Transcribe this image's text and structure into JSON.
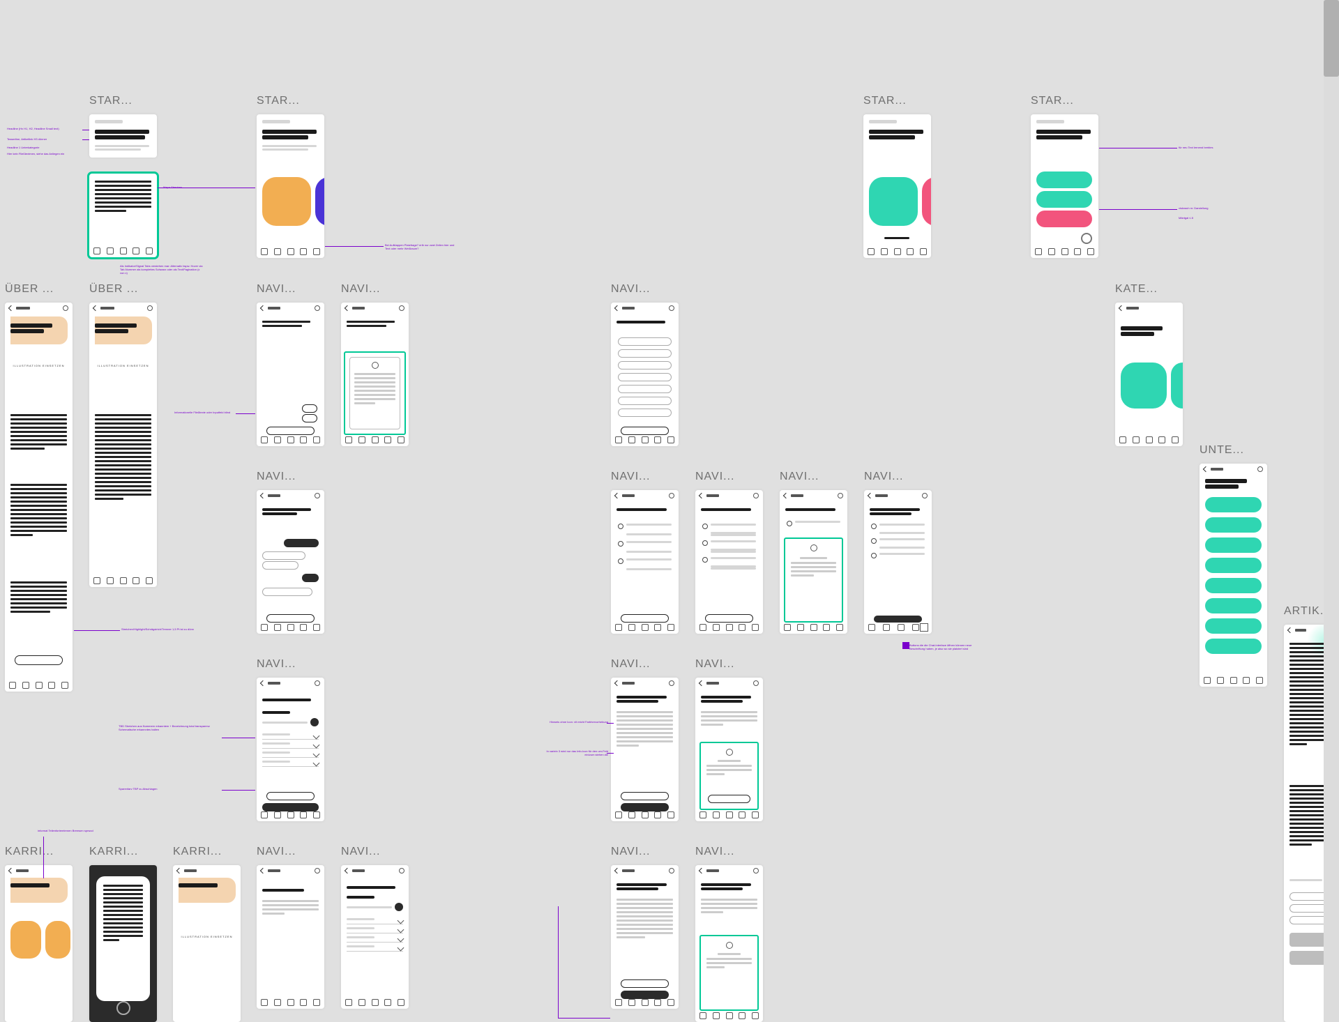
{
  "labels": {
    "star": "STAR...",
    "uber": "ÜBER ...",
    "navi": "NAVI...",
    "kate": "KATE...",
    "unte": "UNTE...",
    "artik": "ARTIK...",
    "karri": "KARRI..."
  },
  "illustration_placeholder": "ILLUSTRATION\nEINSETZEN",
  "annotations": {
    "a1": "Headline (Hx H1, H2, Headline Small text)",
    "a2": "Teaserline, Artikellink H3 dünner",
    "a3": "Headline 1 Unterkategorie",
    "a4": "Hier kein Fließtextmen, siehe das Anliegen ein",
    "a5": "Mapa Strecken",
    "a6": "Als Indikator/Signal Tabs verstehen mar:\nAlternativ bspw. Hover via Tab-Nummer als komplettes Schwarz oder als Text/Pagination (x von x)",
    "a7": "Bei Aufklappen Platzfrage? erlb nur zwei Zeilen hier und Text oder mehr Weißraum?",
    "a8": "Informationelle Fließtexte oder Inputfeld blind",
    "a9": "Streichen/Highlight/Schrägstrich/Trenner 1,5 Pt ist zu dünn",
    "a10": "TBD\nStreichen aus Nummern erkanntem\n+ Bezeichnung total transparenz\nSchematische erkannntes halten",
    "a11": "Sparenfarv TBP zu Abschlagen",
    "a12": "Hinweis ohne Icon: vlt reicht Farbhervorhebung",
    "a13": "In variein 3 wird nur das Info-Icon für den um-Feld ein/zum stehen die",
    "a14": "Buttons die die Chat-Interface öffnen können neue Beschriftung haben, je also wo sie platziert sind",
    "a15": "informat Teilenforterelernen Bremsen sprwod",
    "a16": "für neu Text lernend berbles",
    "a17": "visknach m:\nDarstellung",
    "a18": "Mäntgal ≤ 8"
  }
}
